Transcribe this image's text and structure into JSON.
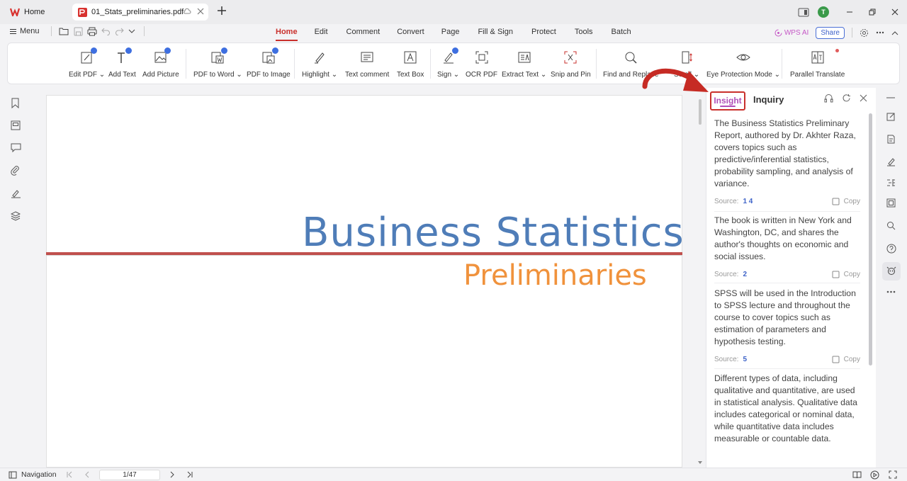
{
  "titlebar": {
    "home_tab": "Home",
    "file_tab": "01_Stats_preliminaries.pdf",
    "avatar_letter": "T"
  },
  "menu": {
    "menu_label": "Menu",
    "tabs": [
      "Home",
      "Edit",
      "Comment",
      "Convert",
      "Page",
      "Fill & Sign",
      "Protect",
      "Tools",
      "Batch"
    ],
    "active_tab": "Home",
    "wps_ai": "WPS AI",
    "share": "Share"
  },
  "ribbon": {
    "tools": [
      {
        "label": "Edit PDF",
        "icon": "edit-pdf-icon",
        "dropdown": true
      },
      {
        "label": "Add Text",
        "icon": "add-text-icon"
      },
      {
        "label": "Add Picture",
        "icon": "add-picture-icon"
      },
      {
        "label": "PDF to Word",
        "icon": "pdf-to-word-icon",
        "dropdown": true
      },
      {
        "label": "PDF to Image",
        "icon": "pdf-to-image-icon"
      },
      {
        "label": "Highlight",
        "icon": "highlight-icon",
        "dropdown": true
      },
      {
        "label": "Text comment",
        "icon": "text-comment-icon"
      },
      {
        "label": "Text Box",
        "icon": "text-box-icon"
      },
      {
        "label": "Sign",
        "icon": "sign-icon",
        "dropdown": true
      },
      {
        "label": "OCR PDF",
        "icon": "ocr-icon"
      },
      {
        "label": "Extract Text",
        "icon": "extract-text-icon",
        "dropdown": true
      },
      {
        "label": "Snip and Pin",
        "icon": "snip-icon"
      },
      {
        "label": "Find and Replace",
        "icon": "search-icon"
      },
      {
        "label": "Scroll",
        "icon": "scroll-icon",
        "dropdown": true
      },
      {
        "label": "Eye Protection Mode",
        "icon": "eye-icon",
        "dropdown": true
      },
      {
        "label": "Parallel Translate",
        "icon": "translate-icon"
      }
    ]
  },
  "document": {
    "title": "Business Statistics",
    "subtitle": "Preliminaries"
  },
  "panel": {
    "tab_insight": "Insight",
    "tab_inquiry": "Inquiry",
    "source_label": "Source:",
    "copy_label": "Copy",
    "cards": [
      {
        "text": "The Business Statistics Preliminary Report, authored by Dr. Akhter Raza, covers topics such as predictive/inferential statistics, probability sampling, and analysis of variance.",
        "sources": "1  4"
      },
      {
        "text": "The book is written in New York and Washington, DC, and shares the author's thoughts on economic and social issues.",
        "sources": "2"
      },
      {
        "text": "SPSS will be used in the Introduction to SPSS lecture and throughout the course to cover topics such as estimation of parameters and hypothesis testing.",
        "sources": "5"
      },
      {
        "text": "Different types of data, including qualitative and quantitative, are used in statistical analysis. Qualitative data includes categorical or nominal data, while quantitative data includes measurable or countable data.",
        "sources": ""
      }
    ]
  },
  "status": {
    "navigation": "Navigation",
    "page_indicator": "1/47"
  },
  "colors": {
    "accent_red": "#c9302c",
    "title_blue": "#4f7db8",
    "subtitle_orange": "#f0923c",
    "ai_purple": "#b050b8"
  }
}
